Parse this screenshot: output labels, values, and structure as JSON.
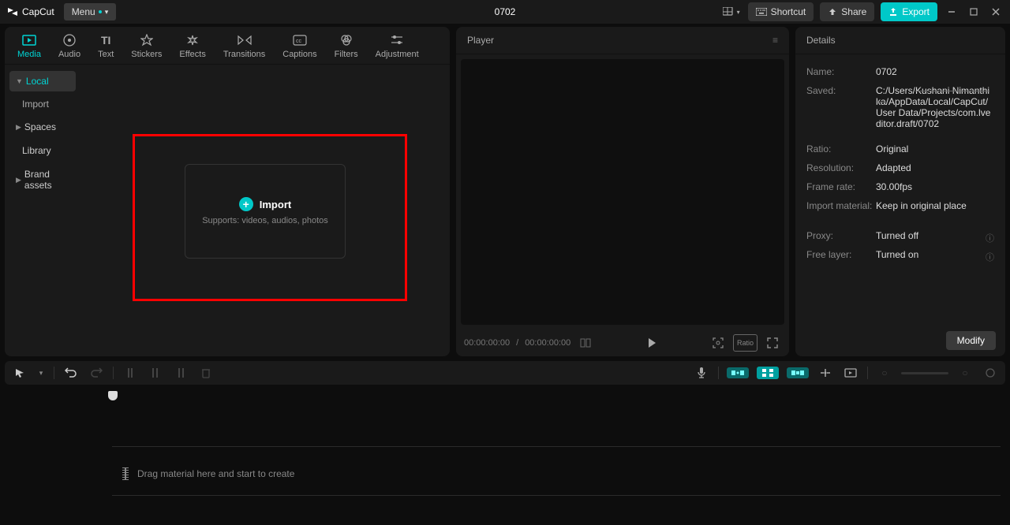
{
  "app": {
    "name": "CapCut"
  },
  "menu": {
    "label": "Menu"
  },
  "project": {
    "title": "0702"
  },
  "titlebar": {
    "shortcut": "Shortcut",
    "share": "Share",
    "export": "Export"
  },
  "tabs": [
    {
      "id": "media",
      "label": "Media"
    },
    {
      "id": "audio",
      "label": "Audio"
    },
    {
      "id": "text",
      "label": "Text"
    },
    {
      "id": "stickers",
      "label": "Stickers"
    },
    {
      "id": "effects",
      "label": "Effects"
    },
    {
      "id": "transitions",
      "label": "Transitions"
    },
    {
      "id": "captions",
      "label": "Captions"
    },
    {
      "id": "filters",
      "label": "Filters"
    },
    {
      "id": "adjustment",
      "label": "Adjustment"
    }
  ],
  "sidebar": {
    "local": "Local",
    "import": "Import",
    "spaces": "Spaces",
    "library": "Library",
    "brand": "Brand assets"
  },
  "import_card": {
    "title": "Import",
    "sub": "Supports: videos, audios, photos"
  },
  "player": {
    "title": "Player",
    "time_current": "00:00:00:00",
    "time_total": "00:00:00:00",
    "ratio_label": "Ratio"
  },
  "details": {
    "title": "Details",
    "name_label": "Name:",
    "name_value": "0702",
    "saved_label": "Saved:",
    "saved_value_pre": "C:/Users/",
    "saved_value_strike": "Kushani Nimanthika",
    "saved_value_post": "/AppData/Local/CapCut/User Data/Projects/com.lveditor.draft/0702",
    "ratio_label": "Ratio:",
    "ratio_value": "Original",
    "resolution_label": "Resolution:",
    "resolution_value": "Adapted",
    "framerate_label": "Frame rate:",
    "framerate_value": "30.00fps",
    "importmaterial_label": "Import material:",
    "importmaterial_value": "Keep in original place",
    "proxy_label": "Proxy:",
    "proxy_value": "Turned off",
    "freelayer_label": "Free layer:",
    "freelayer_value": "Turned on",
    "modify": "Modify"
  },
  "timeline": {
    "drop_hint": "Drag material here and start to create"
  }
}
